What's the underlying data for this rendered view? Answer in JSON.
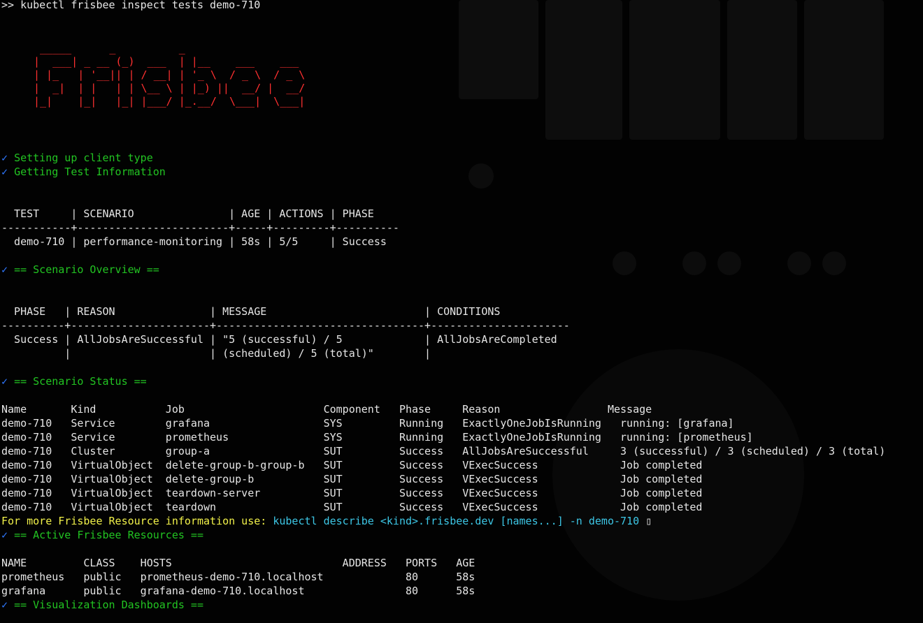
{
  "command": ">> kubectl frisbee inspect tests demo-710",
  "banner": " _____      _          _                     \n|  ___| _ __ (_)  ___  | |__    ___    ___ \n| |_   | '__|| | / __| | '_ \\  / _ \\  / _ \\\n|  _|  | |   | | \\__ \\ | |_) ||  __/ |  __/\n|_|    |_|   |_| |___/ |_.__/  \\___|  \\___|",
  "checkmark": "✓",
  "steps": [
    "Setting up client type",
    "Getting Test Information"
  ],
  "test_table": {
    "header": "  TEST     | SCENARIO               | AGE | ACTIONS | PHASE",
    "separator": "-----------+------------------------+-----+---------+----------",
    "row": "  demo-710 | performance-monitoring | 58s | 5/5     | Success"
  },
  "overview_title": "== Scenario Overview ==",
  "overview_table": {
    "header": "  PHASE   | REASON               | MESSAGE                         | CONDITIONS",
    "separator": "----------+----------------------+---------------------------------+----------------------",
    "row1": "  Success | AllJobsAreSuccessful | \"5 (successful) / 5             | AllJobsAreCompleted",
    "row2": "          |                      | (scheduled) / 5 (total)\"        |"
  },
  "status_title": "== Scenario Status ==",
  "status_table": {
    "header": "Name       Kind           Job                      Component   Phase     Reason                 Message",
    "rows": [
      "demo-710   Service        grafana                  SYS         Running   ExactlyOneJobIsRunning   running: [grafana]",
      "demo-710   Service        prometheus               SYS         Running   ExactlyOneJobIsRunning   running: [prometheus]",
      "demo-710   Cluster        group-a                  SUT         Success   AllJobsAreSuccessful     3 (successful) / 3 (scheduled) / 3 (total)",
      "demo-710   VirtualObject  delete-group-b-group-b   SUT         Success   VExecSuccess             Job completed",
      "demo-710   VirtualObject  delete-group-b           SUT         Success   VExecSuccess             Job completed",
      "demo-710   VirtualObject  teardown-server          SUT         Success   VExecSuccess             Job completed",
      "demo-710   VirtualObject  teardown                 SUT         Success   VExecSuccess             Job completed"
    ]
  },
  "hint": {
    "prefix": "For more Frisbee Resource information use: ",
    "command": "kubectl describe <kind>.frisbee.dev [names...] -n demo-710",
    "glyph": " ▯"
  },
  "active_title": "== Active Frisbee Resources ==",
  "resources_table": {
    "header": "NAME         CLASS    HOSTS                           ADDRESS   PORTS   AGE",
    "rows": [
      "prometheus   public   prometheus-demo-710.localhost             80      58s",
      "grafana      public   grafana-demo-710.localhost                80      58s"
    ]
  },
  "dashboards_title": "== Visualization Dashboards ==",
  "colors": {
    "banner": "#ff3030",
    "check": "#2f78ff",
    "success": "#22c422",
    "hint": "#f2f24a",
    "command": "#3dc7e6"
  }
}
